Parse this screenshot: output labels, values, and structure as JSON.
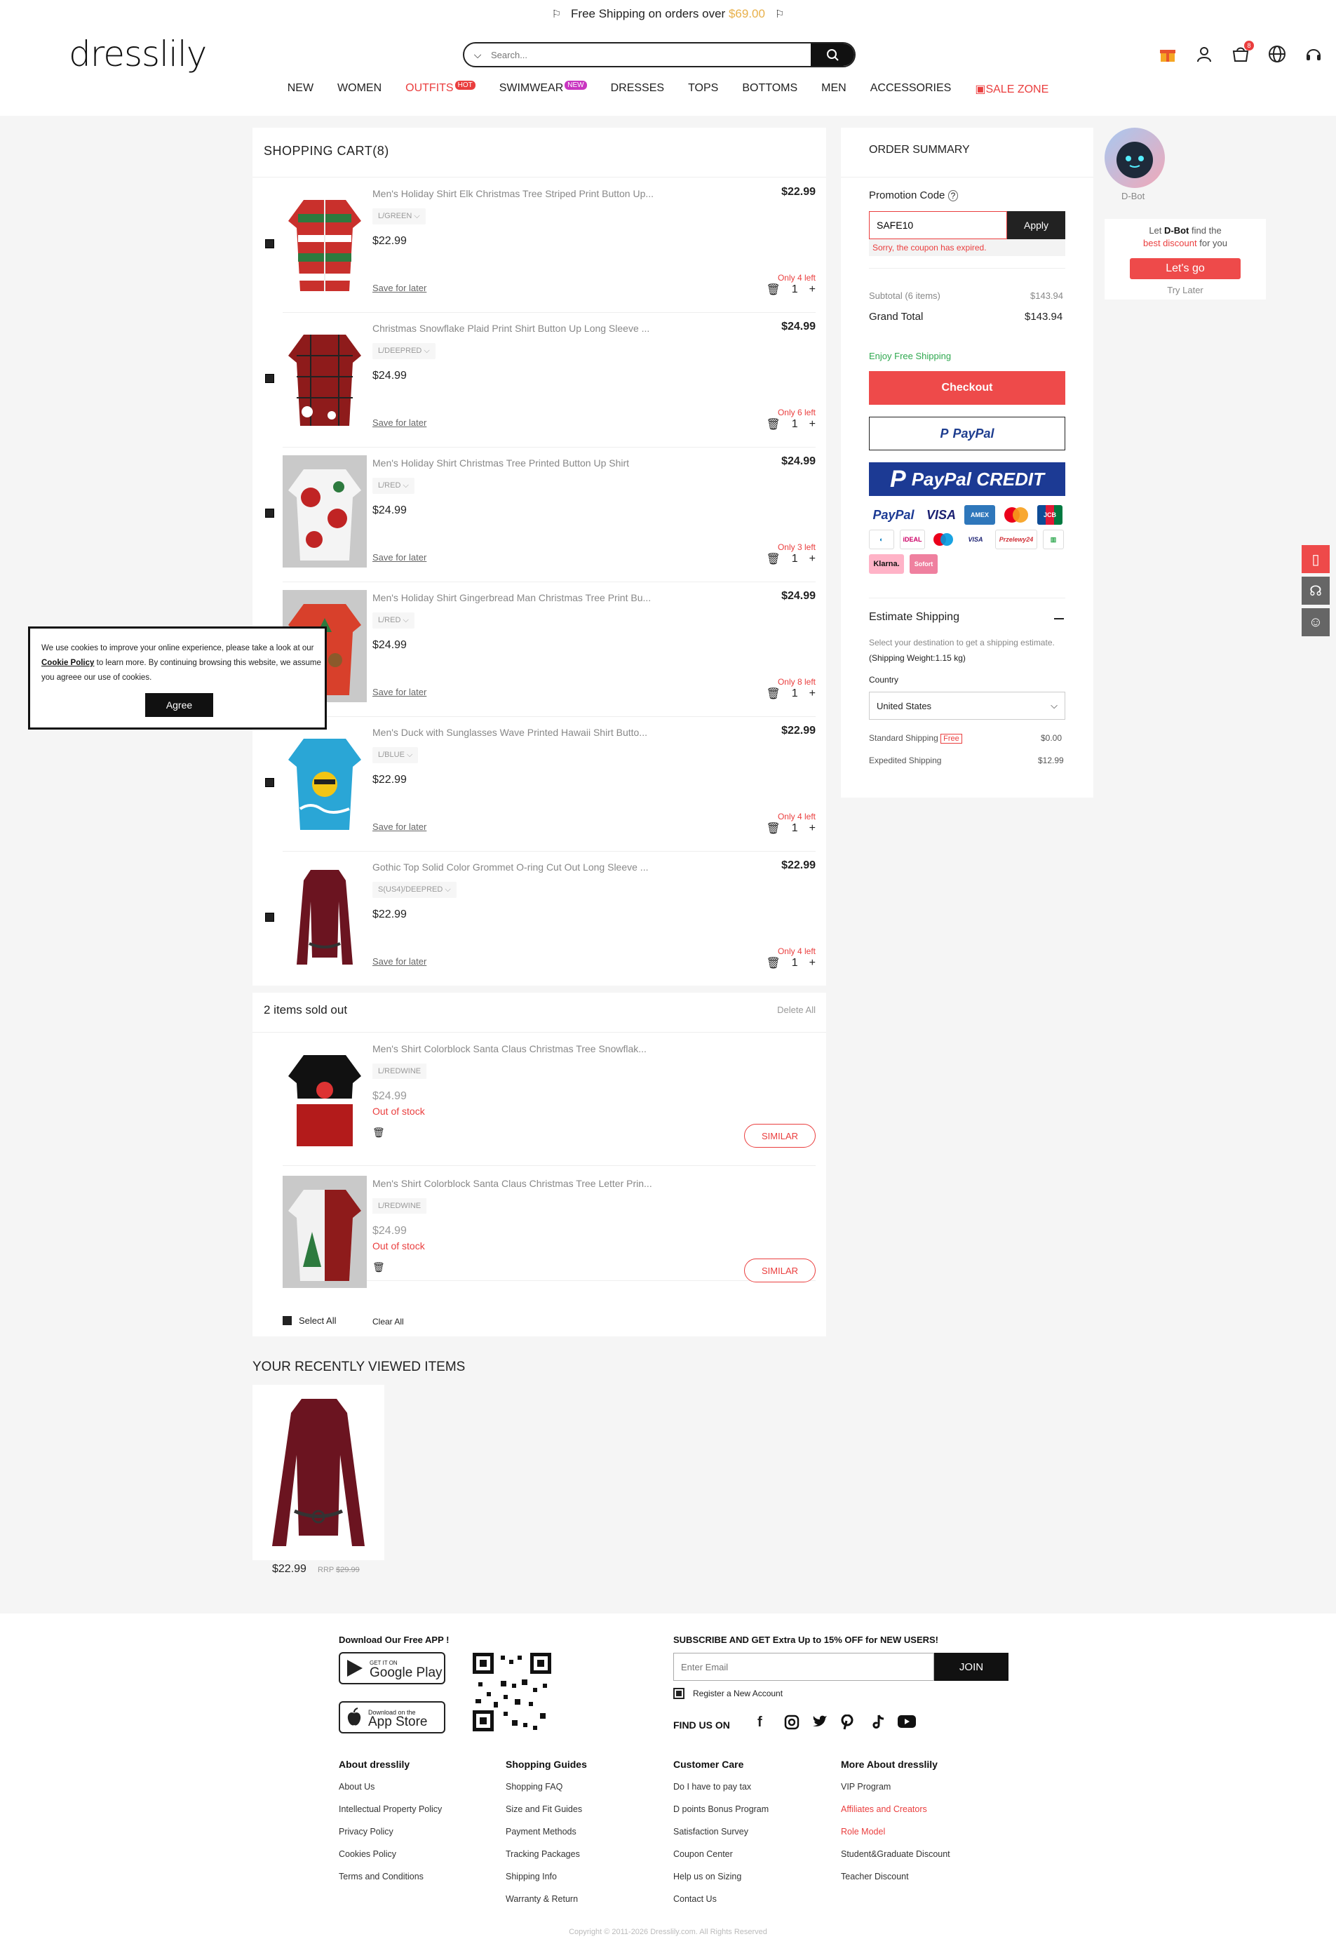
{
  "announcement": {
    "text": "Free Shipping on orders over",
    "amount": "$69.00"
  },
  "brand": {
    "logo": "dresslily"
  },
  "search": {
    "placeholder": "Search..."
  },
  "header_icons": [
    "gift-icon",
    "user-icon",
    "cart-icon",
    "globe-icon",
    "headset-icon"
  ],
  "cart_count_badge": "8",
  "nav": [
    {
      "label": "NEW"
    },
    {
      "label": "WOMEN"
    },
    {
      "label": "OUTFITS",
      "tag": "HOT",
      "red": true
    },
    {
      "label": "SWIMWEAR",
      "tag": "NEW"
    },
    {
      "label": "DRESSES"
    },
    {
      "label": "TOPS"
    },
    {
      "label": "BOTTOMS"
    },
    {
      "label": "MEN"
    },
    {
      "label": "ACCESSORIES"
    },
    {
      "label": "SALE ZONE",
      "red": true
    }
  ],
  "cart": {
    "title": "SHOPPING CART(8)",
    "items": [
      {
        "name": "Men's Holiday Shirt Elk Christmas Tree Striped Print Button Up...",
        "variant": "L/GREEN",
        "price": "$22.99",
        "stock": "Only 4 left",
        "qty": "1",
        "save": "Save for later"
      },
      {
        "name": "Christmas Snowflake Plaid Print Shirt Button Up Long Sleeve ...",
        "variant": "L/DEEPRED",
        "price": "$24.99",
        "stock": "Only 6 left",
        "qty": "1",
        "save": "Save for later"
      },
      {
        "name": "Men's Holiday Shirt Christmas Tree Printed Button Up Shirt",
        "variant": "L/RED",
        "price": "$24.99",
        "stock": "Only 3 left",
        "qty": "1",
        "save": "Save for later"
      },
      {
        "name": "Men's Holiday Shirt Gingerbread Man Christmas Tree Print Bu...",
        "variant": "L/RED",
        "price": "$24.99",
        "stock": "Only 8 left",
        "qty": "1",
        "save": "Save for later"
      },
      {
        "name": "Men's Duck with Sunglasses Wave Printed Hawaii Shirt Butto...",
        "variant": "L/BLUE",
        "price": "$22.99",
        "stock": "Only 4 left",
        "qty": "1",
        "save": "Save for later"
      },
      {
        "name": "Gothic Top Solid Color Grommet O-ring Cut Out Long Sleeve ...",
        "variant": "S(US4)/DEEPRED",
        "price": "$22.99",
        "stock": "Only 4 left",
        "qty": "1",
        "save": "Save for later"
      }
    ],
    "soldout_title": "2 items sold out",
    "delete_all": "Delete All",
    "soldout": [
      {
        "name": "Men's Shirt Colorblock Santa Claus Christmas Tree Snowflak...",
        "variant": "L/REDWINE",
        "price": "$24.99",
        "status": "Out of stock",
        "similar": "SIMILAR"
      },
      {
        "name": "Men's Shirt Colorblock Santa Claus Christmas Tree Letter Prin...",
        "variant": "L/REDWINE",
        "price": "$24.99",
        "status": "Out of stock",
        "similar": "SIMILAR"
      }
    ],
    "select_all": "Select All",
    "clear_all": "Clear All"
  },
  "summary": {
    "title": "ORDER SUMMARY",
    "promo_label": "Promotion Code",
    "promo_value": "SAFE10",
    "apply": "Apply",
    "promo_error": "Sorry, the coupon has expired.",
    "subtotal_label": "Subtotal (6 items)",
    "subtotal": "$143.94",
    "grand_label": "Grand Total",
    "grand": "$143.94",
    "free_ship": "Enjoy Free Shipping",
    "checkout": "Checkout",
    "paypal": "PayPal",
    "paypal_credit": "PayPal CREDIT",
    "estimate_title": "Estimate Shipping",
    "estimate_desc": "Select your destination to get a shipping estimate.",
    "weight": "(Shipping Weight:1.15 kg)",
    "country_label": "Country",
    "country": "United States",
    "ship_std_label": "Standard Shipping",
    "ship_std_tag": "Free",
    "ship_std": "$0.00",
    "ship_exp_label": "Expedited Shipping",
    "ship_exp": "$12.99",
    "pay_logos_row1": [
      "PayPal",
      "VISA",
      "AMEX",
      "Mastercard",
      "JCB"
    ],
    "pay_logos_row2": [
      "Diners",
      "iDEAL",
      "Maestro",
      "VISA",
      "Przelewy24",
      "Boleto"
    ],
    "pay_logos_row3": [
      "Klarna.",
      "Sofort"
    ]
  },
  "dbot": {
    "name": "D-Bot",
    "pre": "Let",
    "bot": "D-Bot",
    "mid": "find the",
    "highlight": "best discount",
    "post": "for you",
    "go": "Let's go",
    "later": "Try Later"
  },
  "cookie": {
    "pre": "We use cookies to improve your online experience, please take a look at our",
    "link": "Cookie Policy",
    "post": "to learn more. By continuing browsing this website, we assume you agreee our use of cookies.",
    "agree": "Agree"
  },
  "recent": {
    "title": "YOUR RECENTLY VIEWED ITEMS",
    "price": "$22.99",
    "rrp_label": "RRP",
    "rrp": "$29.99"
  },
  "footer": {
    "app_title": "Download Our Free APP !",
    "google_small": "GET IT ON",
    "google_big": "Google Play",
    "apple_small": "Download on the",
    "apple_big": "App Store",
    "subscribe_title": "SUBSCRIBE AND GET Extra Up to 15% OFF for NEW USERS!",
    "email_placeholder": "Enter Email",
    "join": "JOIN",
    "register": "Register a New Account",
    "find_us": "FIND US ON",
    "social": [
      "facebook-icon",
      "instagram-icon",
      "twitter-icon",
      "pinterest-icon",
      "tiktok-icon",
      "youtube-icon"
    ],
    "col1": {
      "title": "About dresslily",
      "links": [
        "About Us",
        "Intellectual Property Policy",
        "Privacy Policy",
        "Cookies Policy",
        "Terms and Conditions"
      ]
    },
    "col2": {
      "title": "Shopping Guides",
      "links": [
        "Shopping FAQ",
        "Size and Fit Guides",
        "Payment Methods",
        "Tracking Packages",
        "Shipping Info",
        "Warranty & Return"
      ]
    },
    "col3": {
      "title": "Customer Care",
      "links": [
        "Do I have to pay tax",
        "D points Bonus Program",
        "Satisfaction Survey",
        "Coupon Center",
        "Help us on Sizing",
        "Contact Us"
      ]
    },
    "col4": {
      "title": "More About dresslily",
      "links": [
        "VIP Program",
        "Affiliates and Creators",
        "Role Model",
        "Student&Graduate Discount",
        "Teacher Discount"
      ]
    },
    "copyright": "Copyright © 2011-2026 Dresslily.com. All Rights Reserved"
  },
  "colors": {
    "accent": "#ee4a4a",
    "free_green": "#2fa84f",
    "paypal_blue": "#1c3a94"
  }
}
